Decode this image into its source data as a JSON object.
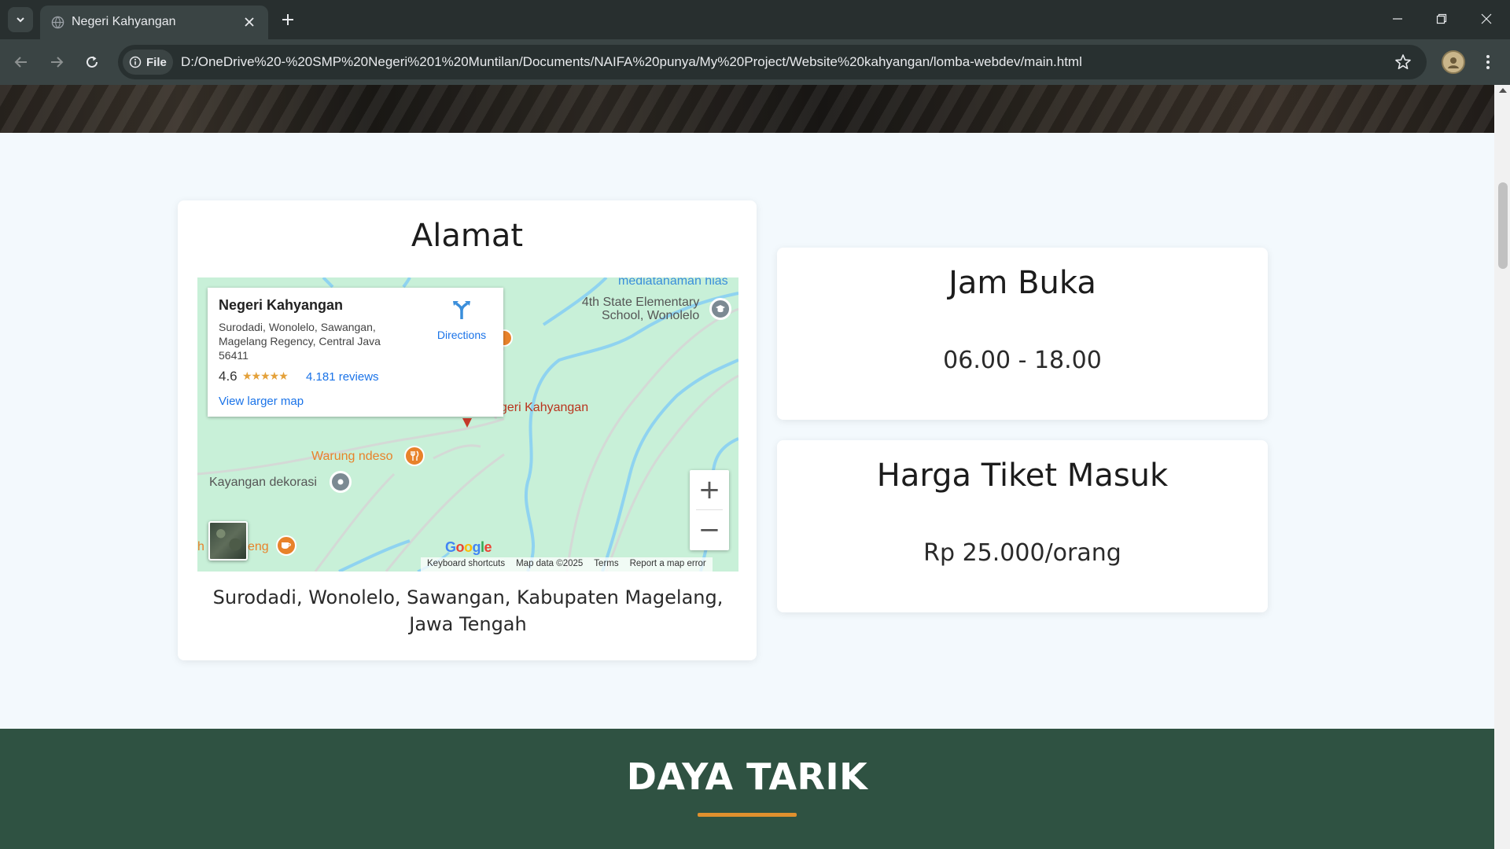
{
  "browser": {
    "tab_title": "Negeri Kahyangan",
    "site_chip_label": "File",
    "url": "D:/OneDrive%20-%20SMP%20Negeri%201%20Muntilan/Documents/NAIFA%20punya/My%20Project/Website%20kahyangan/lomba-webdev/main.html"
  },
  "address_card": {
    "title": "Alamat",
    "address_text": "Surodadi, Wonolelo, Sawangan, Kabupaten Magelang, Jawa Tengah"
  },
  "map": {
    "place_name": "Negeri Kahyangan",
    "place_address": "Surodadi, Wonolelo, Sawangan, Magelang Regency, Central Java 56411",
    "rating": "4.6",
    "stars": "★★★★★",
    "reviews": "4.181 reviews",
    "view_larger": "View larger map",
    "directions": "Directions",
    "labels": {
      "mediatanaman": "mediatanaman hias",
      "school_line1": "4th State Elementary",
      "school_line2": "School, Wonolelo",
      "place_marker": "geri Kahyangan",
      "warung": "Warung ndeso",
      "kayangan": "Kayangan dekorasi",
      "eng": "eng",
      "h": "h"
    },
    "zoom_in": "+",
    "zoom_out": "−",
    "google": "Google",
    "attribution": {
      "keyboard": "Keyboard shortcuts",
      "map_data": "Map data ©2025",
      "terms": "Terms",
      "report": "Report a map error"
    }
  },
  "hours_card": {
    "title": "Jam Buka",
    "value": "06.00 - 18.00"
  },
  "ticket_card": {
    "title": "Harga Tiket Masuk",
    "value": "Rp 25.000/orang"
  },
  "attractions": {
    "title": "DAYA TARIK"
  },
  "colors": {
    "section_green": "#2f5242",
    "accent_orange": "#e0902e",
    "page_bg": "#f3f9fd",
    "map_bg": "#c8f0d8",
    "river": "#8fd3f0"
  }
}
